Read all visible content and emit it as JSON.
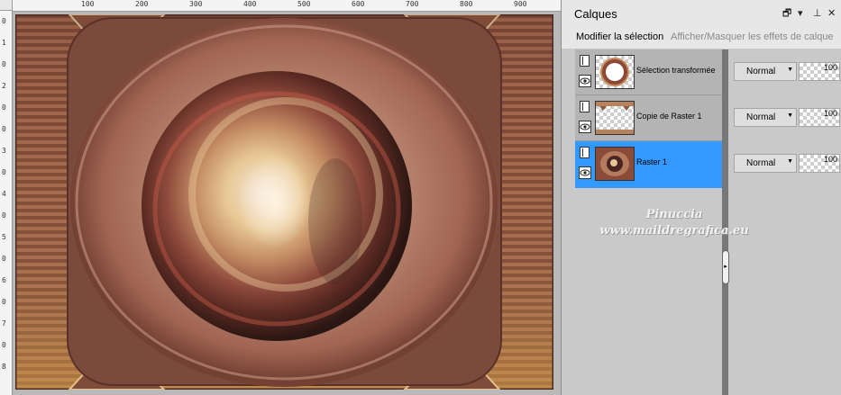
{
  "rulers": {
    "top": [
      "100",
      "200",
      "300",
      "400",
      "500",
      "600",
      "700",
      "800",
      "900"
    ],
    "left": [
      "0",
      "1",
      "0",
      "2",
      "0",
      "0",
      "3",
      "0",
      "4",
      "0",
      "5",
      "0",
      "6",
      "0",
      "7",
      "0",
      "8"
    ]
  },
  "layers_panel": {
    "title": "Calques",
    "header_buttons": [
      {
        "icon": "restore-icon",
        "glyph": "🗗"
      },
      {
        "icon": "menu-arrow-icon",
        "glyph": "▾"
      },
      {
        "icon": "pin-icon",
        "glyph": "⊥"
      },
      {
        "icon": "close-icon",
        "glyph": "✕"
      }
    ],
    "toolbar": {
      "modify_selection": "Modifier la sélection",
      "toggle_effects": "Afficher/Masquer les effets de calque"
    },
    "layers": [
      {
        "name": "Sélection transformée",
        "blend_mode": "Normal",
        "opacity": "100",
        "selected": false,
        "thumb": "ring"
      },
      {
        "name": "Copie de Raster 1",
        "blend_mode": "Normal",
        "opacity": "100",
        "selected": false,
        "thumb": "frame"
      },
      {
        "name": "Raster 1",
        "blend_mode": "Normal",
        "opacity": "100",
        "selected": true,
        "thumb": "image"
      }
    ],
    "watermark": {
      "line1": "Pinuccia",
      "line2": "www.maildregrafica.eu"
    }
  },
  "colors": {
    "selected_layer": "#3399ff",
    "panel_bg": "#c9c9c9"
  }
}
